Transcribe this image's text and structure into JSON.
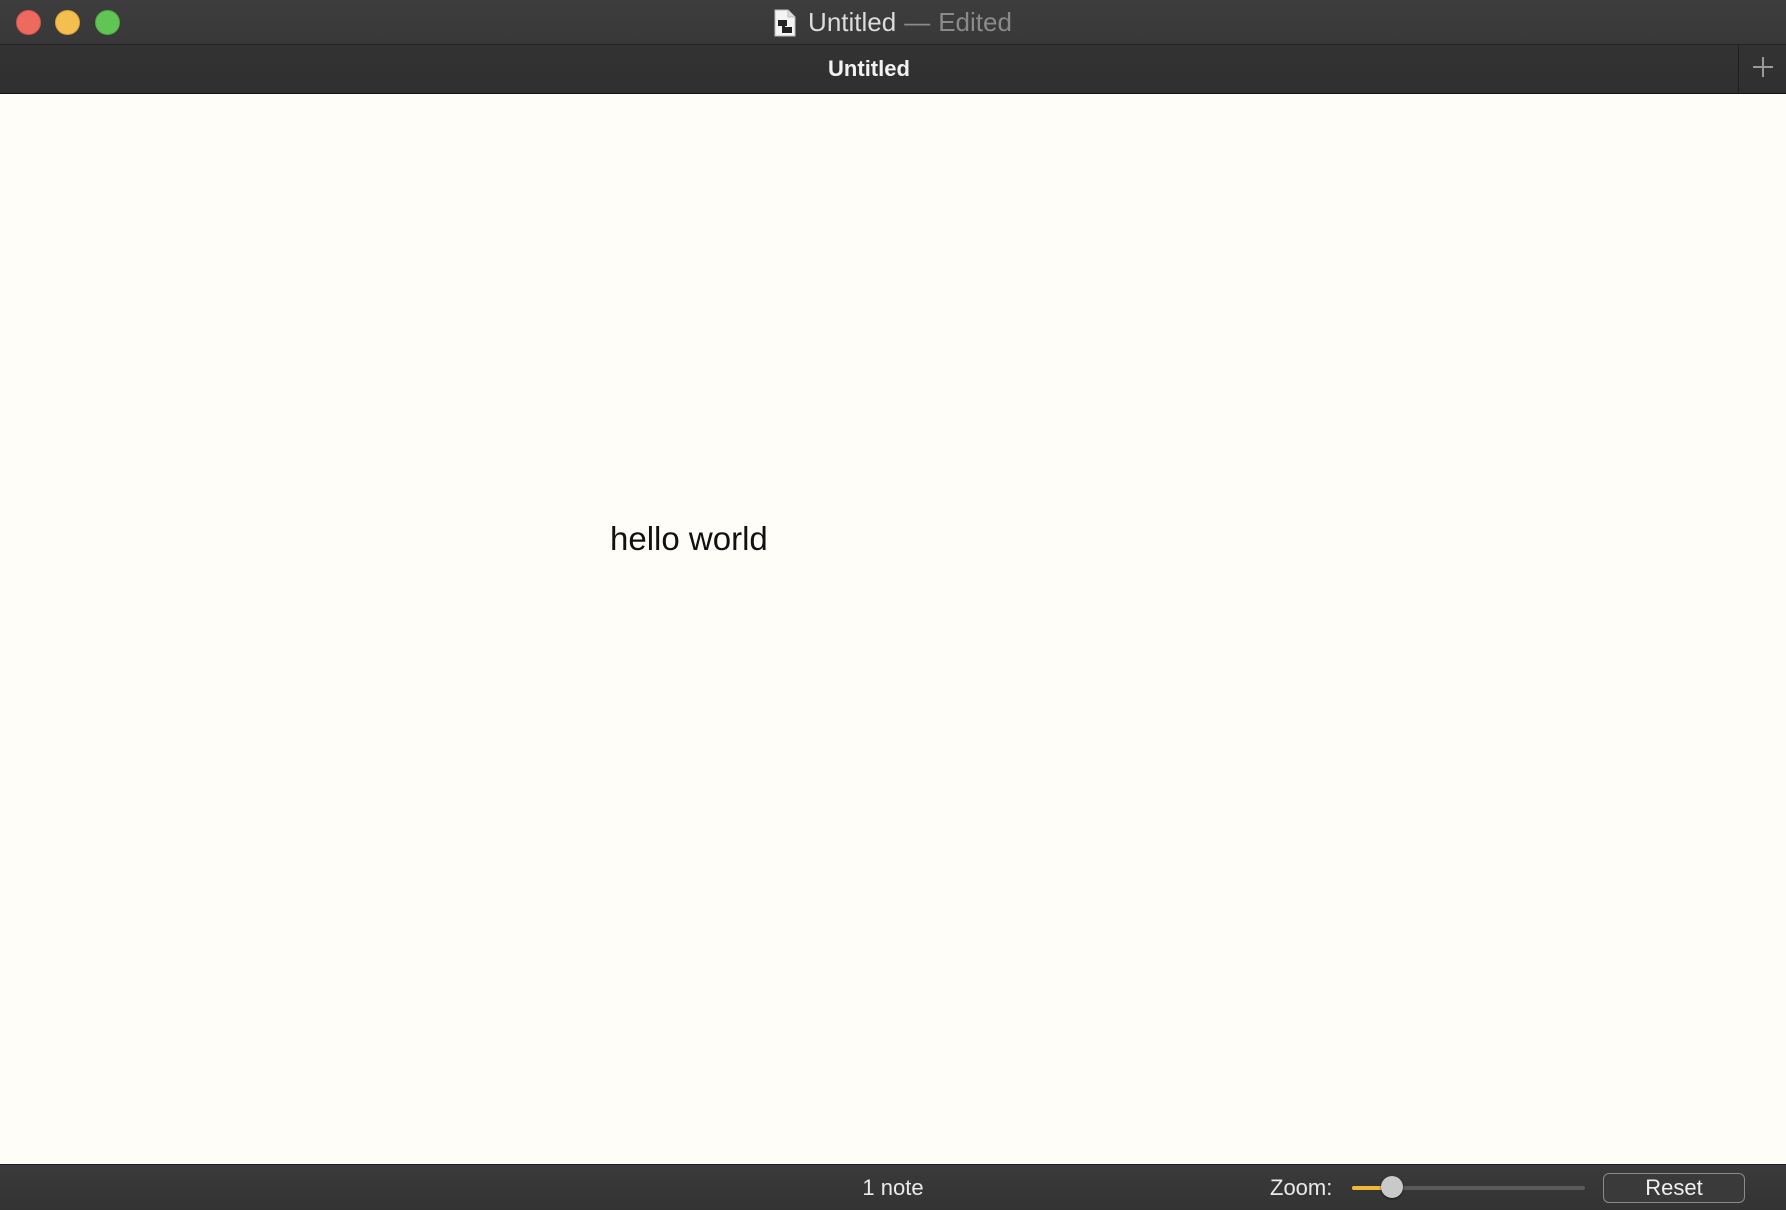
{
  "window": {
    "title": "Untitled",
    "separator": "—",
    "status": "Edited",
    "document_icon": "document-icon",
    "controls": {
      "close_color": "#ed6a5e",
      "minimize_color": "#f4bf4f",
      "zoom_color": "#61c554"
    }
  },
  "tabs": [
    {
      "label": "Untitled",
      "active": true
    }
  ],
  "new_tab_icon": "plus-icon",
  "canvas": {
    "notes": [
      {
        "text": "hello world"
      }
    ]
  },
  "statusbar": {
    "note_count": "1 note",
    "zoom_label": "Zoom:",
    "zoom_fraction": 0.17,
    "zoom_accent": "#f2b63a",
    "reset_label": "Reset"
  }
}
